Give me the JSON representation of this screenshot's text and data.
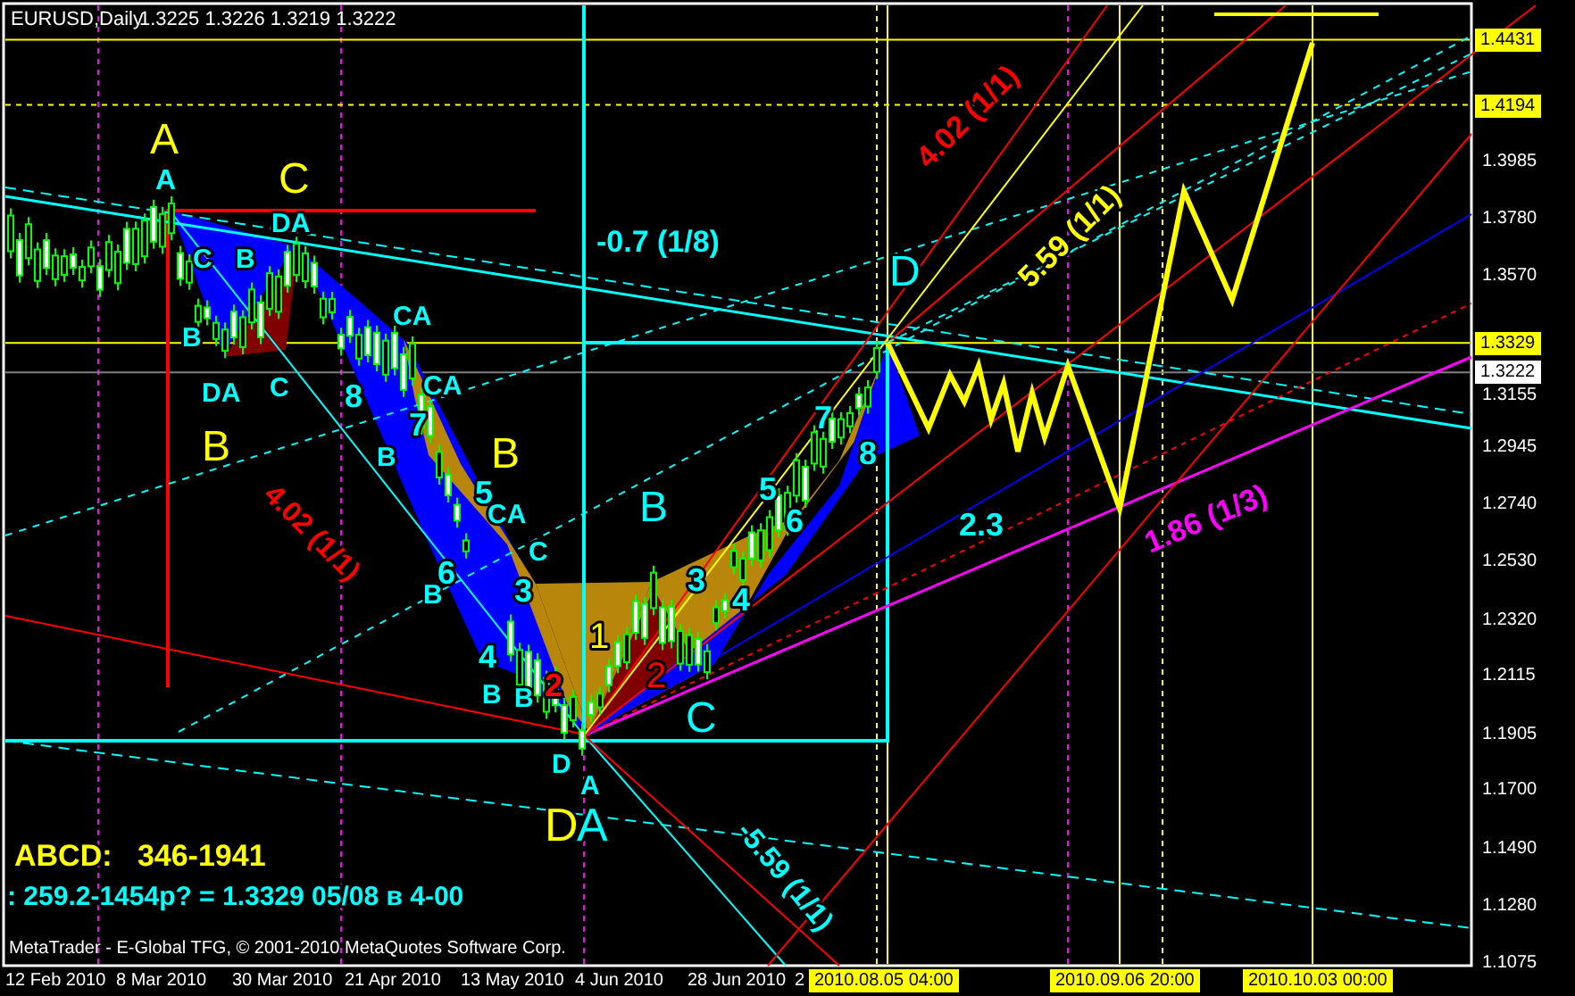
{
  "header": {
    "title": "EURUSD,Daily",
    "quote": "1.3225 1.3226 1.3219 1.3222"
  },
  "labels": [
    {
      "text": "A",
      "color": "#ffff00"
    },
    {
      "text": "A",
      "color": "#00ffff"
    },
    {
      "text": "C",
      "color": "#ffff00"
    },
    {
      "text": "DA",
      "color": "#00ffff"
    },
    {
      "text": "C",
      "color": "#00ffff"
    },
    {
      "text": "B",
      "color": "#00ffff"
    },
    {
      "text": "B",
      "color": "#00ffff"
    },
    {
      "text": "DA",
      "color": "#00ffff"
    },
    {
      "text": "C",
      "color": "#00ffff"
    },
    {
      "text": "B",
      "color": "#ffff00"
    },
    {
      "text": "CA",
      "color": "#00ffff"
    },
    {
      "text": "8",
      "color": "#00ffff"
    },
    {
      "text": "CA",
      "color": "#00ffff"
    },
    {
      "text": "7",
      "color": "#00ffff"
    },
    {
      "text": "B",
      "color": "#00ffff"
    },
    {
      "text": "B",
      "color": "#ffff00"
    },
    {
      "text": "5",
      "color": "#00ffff"
    },
    {
      "text": "CA",
      "color": "#00ffff"
    },
    {
      "text": "C",
      "color": "#00ffff"
    },
    {
      "text": "6",
      "color": "#00ffff"
    },
    {
      "text": "B",
      "color": "#00ffff"
    },
    {
      "text": "3",
      "color": "#00ffff"
    },
    {
      "text": "4",
      "color": "#00ffff"
    },
    {
      "text": "B",
      "color": "#00ffff"
    },
    {
      "text": "B",
      "color": "#00ffff"
    },
    {
      "text": "2",
      "color": "#ff0000"
    },
    {
      "text": "B",
      "color": "#00ffff"
    },
    {
      "text": "1",
      "color": "#ffff00"
    },
    {
      "text": "2",
      "color": "#ff0000"
    },
    {
      "text": "3",
      "color": "#00ffff"
    },
    {
      "text": "4",
      "color": "#00ffff"
    },
    {
      "text": "5",
      "color": "#00ffff"
    },
    {
      "text": "6",
      "color": "#00ffff"
    },
    {
      "text": "7",
      "color": "#00ffff"
    },
    {
      "text": "8",
      "color": "#00ffff"
    },
    {
      "text": "C",
      "color": "#00ffff"
    },
    {
      "text": "D",
      "color": "#00ffff"
    },
    {
      "text": "-0.7 (1/8)",
      "color": "#00ffff"
    },
    {
      "text": "4.02 (1/1)",
      "color": "#ff0000"
    },
    {
      "text": "5.59 (1/1)",
      "color": "#ffff00"
    },
    {
      "text": "4.02 (1/1)",
      "color": "#ff0000"
    },
    {
      "text": "2.3",
      "color": "#00ffff"
    },
    {
      "text": "1.86 (1/3)",
      "color": "#ff00ff"
    },
    {
      "text": "D",
      "color": "#00ffff"
    },
    {
      "text": "A",
      "color": "#00ffff"
    },
    {
      "text": "D",
      "color": "#ffff00"
    },
    {
      "text": "A",
      "color": "#00ffff"
    },
    {
      "text": "-5.59 (1/1)",
      "color": "#00ffff"
    },
    {
      "text": "ABCD:   346-1941",
      "color": "#ffff00"
    },
    {
      "text": ": 259.2-1454p? = 1.3329 05/08 в 4-00",
      "color": "#00ffff"
    }
  ],
  "copyright": "MetaTrader - E-Global TFG, © 2001-2010 MetaQuotes Software Corp.",
  "price_axis": {
    "ticks": [
      "1.3985",
      "1.3780",
      "1.3570",
      "1.3155",
      "1.2945",
      "1.2740",
      "1.2530",
      "1.2320",
      "1.2115",
      "1.1905",
      "1.1700",
      "1.1490",
      "1.1280",
      "1.1075"
    ],
    "markers": [
      {
        "text": "1.4431",
        "color": "#ffff00"
      },
      {
        "text": "1.4194",
        "color": "#ffff00"
      },
      {
        "text": "1.3329",
        "color": "#ffff00"
      },
      {
        "text": "1.3222",
        "color": "#ffffff"
      }
    ]
  },
  "date_axis": {
    "ticks": [
      "12 Feb 2010",
      "8 Mar 2010",
      "30 Mar 2010",
      "21 Apr 2010",
      "13 May 2010",
      "4 Jun 2010",
      "28 Jun 2010",
      "2"
    ],
    "markers": [
      "2010.08.05 04:00",
      "2010.09.06 20:00",
      "2010.10.03 00:00"
    ]
  }
}
